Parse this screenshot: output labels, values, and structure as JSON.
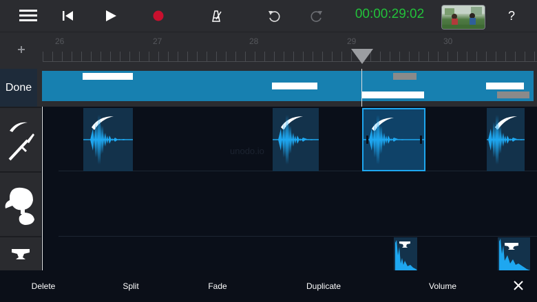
{
  "toolbar": {
    "timecode": "00:00:29:02",
    "help_label": "?",
    "icons": [
      "menu-icon",
      "skip-back-icon",
      "play-icon",
      "record-icon",
      "metronome-icon",
      "undo-icon",
      "redo-icon"
    ]
  },
  "ruler": {
    "labels": [
      "26",
      "27",
      "28",
      "29",
      "30"
    ]
  },
  "summary": {
    "done_label": "Done"
  },
  "tracks": [
    {
      "name": "sword-slash-track",
      "icon": "sword-icon"
    },
    {
      "name": "punch-track",
      "icon": "fist-icon"
    },
    {
      "name": "anvil-track",
      "icon": "anvil-icon"
    }
  ],
  "watermark": "unodo.io",
  "bottom_bar": {
    "delete_label": "Delete",
    "split_label": "Split",
    "fade_label": "Fade",
    "duplicate_label": "Duplicate",
    "volume_label": "Volume"
  },
  "colors": {
    "accent": "#1ea7f0",
    "timecode": "#22c13a",
    "record": "#c8102e",
    "overview": "#1780b0"
  }
}
